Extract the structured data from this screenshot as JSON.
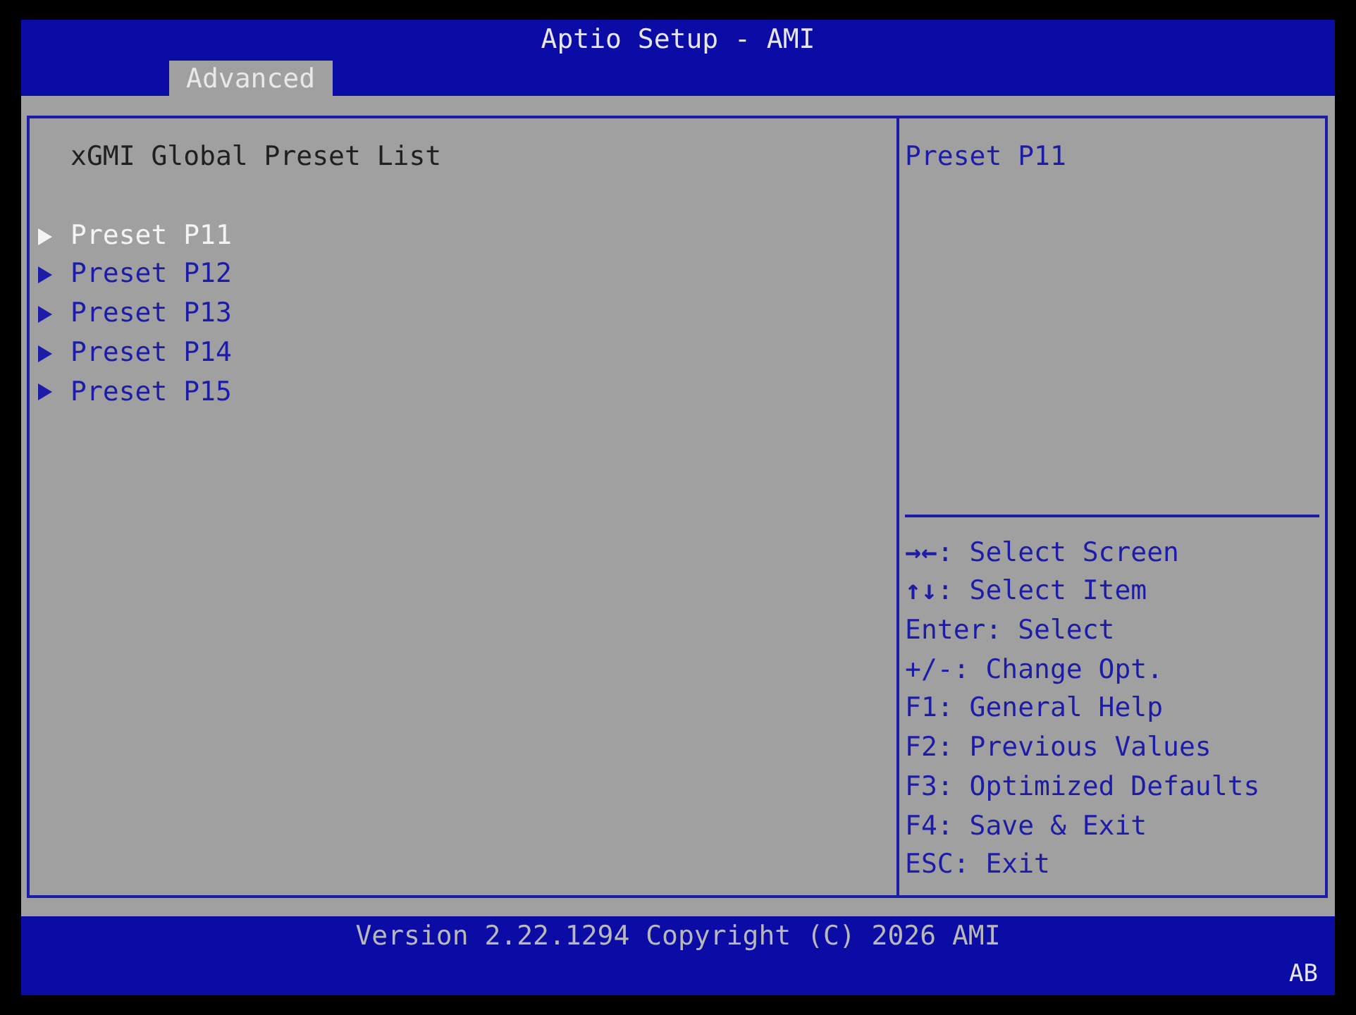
{
  "window": {
    "title": "Aptio Setup - AMI"
  },
  "tabs": [
    {
      "label": "Advanced",
      "selected": true
    }
  ],
  "main": {
    "heading": "xGMI Global Preset List",
    "items": [
      {
        "label": "Preset P11",
        "selected": true
      },
      {
        "label": "Preset P12",
        "selected": false
      },
      {
        "label": "Preset P13",
        "selected": false
      },
      {
        "label": "Preset P14",
        "selected": false
      },
      {
        "label": "Preset P15",
        "selected": false
      }
    ]
  },
  "help": {
    "text": "Preset P11",
    "keys": [
      {
        "key": "→←",
        "action": ": Select Screen"
      },
      {
        "key": "↑↓",
        "action": ": Select Item"
      },
      {
        "key": "Enter",
        "action": ": Select"
      },
      {
        "key": "+/-",
        "action": ": Change Opt."
      },
      {
        "key": "F1",
        "action": ": General Help"
      },
      {
        "key": "F2",
        "action": ": Previous Values"
      },
      {
        "key": "F3",
        "action": ": Optimized Defaults"
      },
      {
        "key": "F4",
        "action": ": Save & Exit"
      },
      {
        "key": "ESC",
        "action": ": Exit"
      }
    ]
  },
  "footer": {
    "version": "Version 2.22.1294 Copyright (C) 2026 AMI",
    "badge": "AB"
  }
}
